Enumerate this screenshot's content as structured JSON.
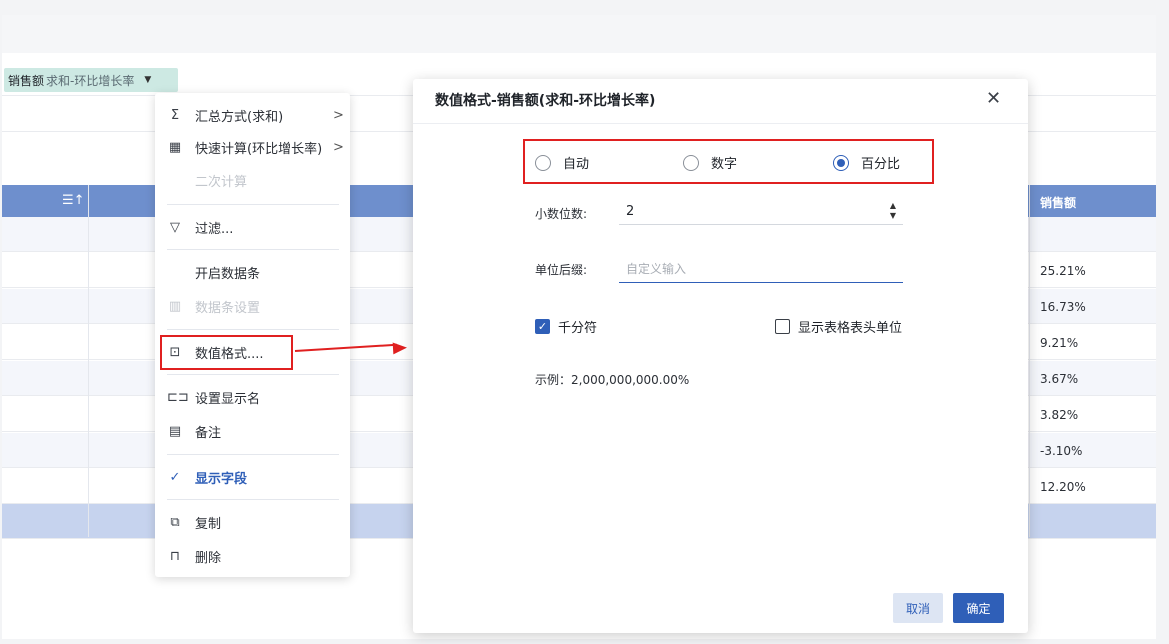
{
  "field_chip": {
    "name": "销售额",
    "agg": "求和-环比增长率",
    "caret": "▼"
  },
  "table": {
    "sort_icon": "☰↑",
    "right_header": "销售额",
    "values": [
      "25.21%",
      "16.73%",
      "9.21%",
      "3.67%",
      "3.82%",
      "-3.10%",
      "12.20%"
    ]
  },
  "context_menu": {
    "items": [
      {
        "icon": "Σ",
        "label": "汇总方式(求和)",
        "arrow": ">"
      },
      {
        "icon": "▦",
        "label": "快速计算(环比增长率)",
        "arrow": ">"
      },
      {
        "label": "二次计算"
      },
      {
        "icon": "▽",
        "label": "过滤..."
      },
      {
        "label": "开启数据条"
      },
      {
        "icon": "▥",
        "label": "数据条设置"
      },
      {
        "icon": "⊡",
        "label": "数值格式...."
      },
      {
        "icon": "⊏⊐",
        "label": "设置显示名"
      },
      {
        "icon": "▤",
        "label": "备注"
      },
      {
        "icon": "✓",
        "label": "显示字段"
      },
      {
        "icon": "⧉",
        "label": "复制"
      },
      {
        "icon": "⊓",
        "label": "删除"
      }
    ]
  },
  "dialog": {
    "title": "数值格式-销售额(求和-环比增长率)",
    "close": "✕",
    "radios": [
      {
        "label": "自动",
        "checked": false
      },
      {
        "label": "数字",
        "checked": false
      },
      {
        "label": "百分比",
        "checked": true
      }
    ],
    "decimals_label": "小数位数:",
    "decimals_value": "2",
    "spin_up": "▲",
    "spin_down": "▼",
    "suffix_label": "单位后缀:",
    "suffix_placeholder": "自定义输入",
    "thousands_label": "千分符",
    "thousands_checked": true,
    "header_unit_label": "显示表格表头单位",
    "header_unit_checked": false,
    "example": "示例：2,000,000,000.00%",
    "cancel": "取消",
    "ok": "确定"
  },
  "colors": {
    "accent": "#2f5fb8",
    "table_header": "#6e8fcd",
    "highlight": "#e02020",
    "chip": "#cde9e3"
  }
}
